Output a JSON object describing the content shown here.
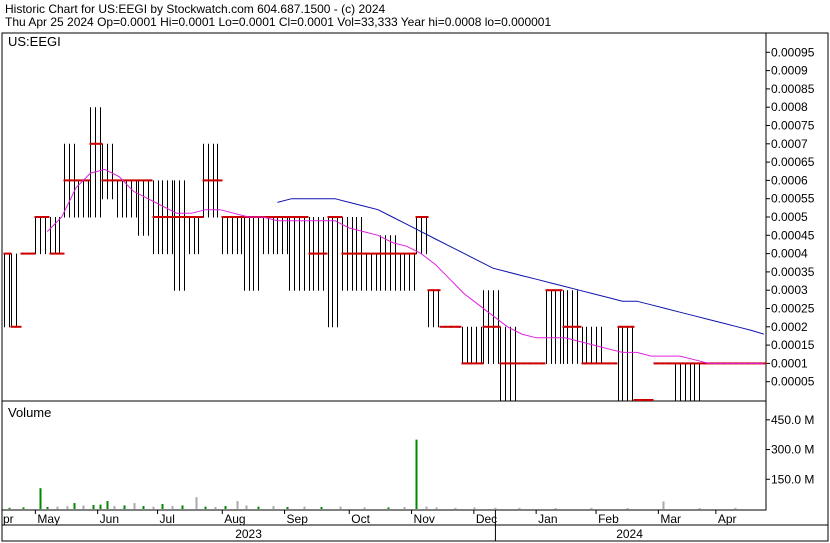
{
  "header": {
    "line1": "Historic Chart for US:EEGI by Stockwatch.com 604.687.1500 - (c) 2024",
    "line2": "Thu Apr 25 2024   Op=0.0001   Hi=0.0001   Lo=0.0001   Cl=0.0001   Vol=33,333   Year hi=0.0008   lo=0.000001"
  },
  "price_panel": {
    "symbol_label": "US:EEGI"
  },
  "volume_panel": {
    "label": "Volume"
  },
  "colors": {
    "price_bar": "#000000",
    "close_tick": "#cc0000",
    "ma_short": "#e020e0",
    "ma_long": "#1010b0",
    "volume_up": "#008800",
    "volume_flat": "#aaaaaa",
    "volume_down": "#cc0000",
    "axis": "#000000"
  },
  "chart_data": [
    {
      "type": "ohlc",
      "title": "Historic Chart for US:EEGI",
      "ylim": [
        0,
        0.0001
      ],
      "y_ticks": [
        "0.00005",
        "0.0001",
        "0.00015",
        "0.0002",
        "0.00025",
        "0.0003",
        "0.00035",
        "0.0004",
        "0.00045",
        "0.0005",
        "0.00055",
        "0.0006",
        "0.00065",
        "0.0007",
        "0.00075",
        "0.0008",
        "0.00085",
        "0.0009",
        "0.00095"
      ],
      "y_tick_values": [
        5e-05,
        0.0001,
        0.00015,
        0.0002,
        0.00025,
        0.0003,
        0.00035,
        0.0004,
        0.00045,
        0.0005,
        0.00055,
        0.0006,
        0.00065,
        0.0007,
        0.00075,
        0.0008,
        0.00085,
        0.0009,
        0.00095
      ],
      "y_range": [
        0,
        0.001
      ],
      "x_months": [
        "pr",
        "May",
        "Jun",
        "Jul",
        "Aug",
        "Sep",
        "Oct",
        "Nov",
        "Dec",
        "Jan",
        "Feb",
        "Mar",
        "Apr"
      ],
      "x_years": [
        "2023",
        "2024"
      ],
      "segments": [
        {
          "from": 0,
          "to": 2,
          "close": 0.0004,
          "high": 0.0004,
          "low": 0.0002
        },
        {
          "from": 3,
          "to": 6,
          "close": 0.0002,
          "high": 0.0004,
          "low": 0.0002
        },
        {
          "from": 7,
          "to": 12,
          "close": 0.0004,
          "high": 0.0004,
          "low": 0.0004
        },
        {
          "from": 13,
          "to": 18,
          "close": 0.0005,
          "high": 0.0005,
          "low": 0.0004
        },
        {
          "from": 19,
          "to": 24,
          "close": 0.0004,
          "high": 0.0005,
          "low": 0.0004
        },
        {
          "from": 25,
          "to": 30,
          "close": 0.0006,
          "high": 0.0007,
          "low": 0.0005
        },
        {
          "from": 31,
          "to": 35,
          "close": 0.0006,
          "high": 0.0006,
          "low": 0.0005
        },
        {
          "from": 36,
          "to": 40,
          "close": 0.0007,
          "high": 0.0008,
          "low": 0.0005
        },
        {
          "from": 41,
          "to": 46,
          "close": 0.0006,
          "high": 0.0007,
          "low": 0.00055
        },
        {
          "from": 47,
          "to": 55,
          "close": 0.0006,
          "high": 0.0006,
          "low": 0.0005
        },
        {
          "from": 56,
          "to": 61,
          "close": 0.0006,
          "high": 0.0006,
          "low": 0.00045
        },
        {
          "from": 62,
          "to": 70,
          "close": 0.0005,
          "high": 0.0006,
          "low": 0.0004
        },
        {
          "from": 71,
          "to": 76,
          "close": 0.0005,
          "high": 0.0006,
          "low": 0.0003
        },
        {
          "from": 77,
          "to": 82,
          "close": 0.0005,
          "high": 0.0005,
          "low": 0.0004
        },
        {
          "from": 83,
          "to": 90,
          "close": 0.0006,
          "high": 0.0007,
          "low": 0.0005
        },
        {
          "from": 91,
          "to": 99,
          "close": 0.0005,
          "high": 0.0005,
          "low": 0.0004
        },
        {
          "from": 100,
          "to": 107,
          "close": 0.0005,
          "high": 0.0005,
          "low": 0.0003
        },
        {
          "from": 108,
          "to": 118,
          "close": 0.0005,
          "high": 0.0005,
          "low": 0.0004
        },
        {
          "from": 119,
          "to": 126,
          "close": 0.0005,
          "high": 0.0005,
          "low": 0.0003
        },
        {
          "from": 127,
          "to": 134,
          "close": 0.0004,
          "high": 0.0005,
          "low": 0.0003
        },
        {
          "from": 135,
          "to": 140,
          "close": 0.0005,
          "high": 0.0005,
          "low": 0.0002
        },
        {
          "from": 141,
          "to": 150,
          "close": 0.0004,
          "high": 0.0005,
          "low": 0.0003
        },
        {
          "from": 151,
          "to": 156,
          "close": 0.0004,
          "high": 0.0004,
          "low": 0.0003
        },
        {
          "from": 157,
          "to": 164,
          "close": 0.0004,
          "high": 0.00045,
          "low": 0.0003
        },
        {
          "from": 165,
          "to": 171,
          "close": 0.0004,
          "high": 0.0004,
          "low": 0.0003
        },
        {
          "from": 172,
          "to": 176,
          "close": 0.0005,
          "high": 0.0005,
          "low": 0.0004
        },
        {
          "from": 177,
          "to": 181,
          "close": 0.0003,
          "high": 0.0003,
          "low": 0.0002
        },
        {
          "from": 182,
          "to": 190,
          "close": 0.0002,
          "high": 0.0002,
          "low": 0.0002
        },
        {
          "from": 191,
          "to": 199,
          "close": 0.0001,
          "high": 0.0002,
          "low": 0.0001
        },
        {
          "from": 200,
          "to": 206,
          "close": 0.0002,
          "high": 0.0003,
          "low": 0.0001
        },
        {
          "from": 207,
          "to": 213,
          "close": 0.0001,
          "high": 0.0002,
          "low": 0.0
        },
        {
          "from": 214,
          "to": 225,
          "close": 0.0001,
          "high": 0.0001,
          "low": 0.0001
        },
        {
          "from": 226,
          "to": 232,
          "close": 0.0003,
          "high": 0.0003,
          "low": 0.0001
        },
        {
          "from": 233,
          "to": 240,
          "close": 0.0002,
          "high": 0.0003,
          "low": 0.0001
        },
        {
          "from": 241,
          "to": 250,
          "close": 0.0001,
          "high": 0.0002,
          "low": 0.0001
        },
        {
          "from": 251,
          "to": 255,
          "close": 0.0001,
          "high": 0.0001,
          "low": 0.0001
        },
        {
          "from": 256,
          "to": 262,
          "close": 0.0002,
          "high": 0.0002,
          "low": 0.0
        },
        {
          "from": 263,
          "to": 270,
          "close": 0.0,
          "high": 0.0,
          "low": 0.0
        },
        {
          "from": 271,
          "to": 279,
          "close": 0.0001,
          "high": 0.0001,
          "low": 0.0001
        },
        {
          "from": 280,
          "to": 290,
          "close": 0.0001,
          "high": 0.0001,
          "low": 0.0
        },
        {
          "from": 291,
          "to": 317,
          "close": 0.0001,
          "high": 0.0001,
          "low": 0.0001
        }
      ],
      "ma_short": [
        [
          18,
          0.00046
        ],
        [
          24,
          0.0005
        ],
        [
          30,
          0.00058
        ],
        [
          36,
          0.00062
        ],
        [
          42,
          0.00063
        ],
        [
          48,
          0.00061
        ],
        [
          54,
          0.00057
        ],
        [
          60,
          0.00055
        ],
        [
          66,
          0.00053
        ],
        [
          72,
          0.00051
        ],
        [
          78,
          0.00051
        ],
        [
          84,
          0.00052
        ],
        [
          90,
          0.00052
        ],
        [
          96,
          0.00051
        ],
        [
          102,
          0.0005
        ],
        [
          108,
          0.0005
        ],
        [
          114,
          0.00049
        ],
        [
          120,
          0.00049
        ],
        [
          126,
          0.00049
        ],
        [
          132,
          0.00049
        ],
        [
          138,
          0.00049
        ],
        [
          144,
          0.00047
        ],
        [
          150,
          0.00046
        ],
        [
          156,
          0.00045
        ],
        [
          162,
          0.00043
        ],
        [
          168,
          0.00042
        ],
        [
          174,
          0.0004
        ],
        [
          180,
          0.00037
        ],
        [
          186,
          0.00033
        ],
        [
          192,
          0.00029
        ],
        [
          198,
          0.00026
        ],
        [
          204,
          0.00023
        ],
        [
          210,
          0.0002
        ],
        [
          216,
          0.00018
        ],
        [
          222,
          0.00017
        ],
        [
          228,
          0.00017
        ],
        [
          234,
          0.00017
        ],
        [
          240,
          0.00016
        ],
        [
          246,
          0.00015
        ],
        [
          252,
          0.00014
        ],
        [
          258,
          0.00013
        ],
        [
          264,
          0.00013
        ],
        [
          270,
          0.00012
        ],
        [
          276,
          0.00012
        ],
        [
          282,
          0.00012
        ],
        [
          288,
          0.00011
        ],
        [
          294,
          0.0001
        ],
        [
          300,
          0.0001
        ],
        [
          306,
          0.0001
        ],
        [
          317,
          0.0001
        ]
      ],
      "ma_long": [
        [
          114,
          0.00054
        ],
        [
          120,
          0.00055
        ],
        [
          126,
          0.00055
        ],
        [
          132,
          0.00055
        ],
        [
          138,
          0.00055
        ],
        [
          144,
          0.00054
        ],
        [
          150,
          0.00053
        ],
        [
          156,
          0.00052
        ],
        [
          162,
          0.0005
        ],
        [
          168,
          0.00048
        ],
        [
          174,
          0.00046
        ],
        [
          180,
          0.00044
        ],
        [
          186,
          0.00042
        ],
        [
          192,
          0.0004
        ],
        [
          198,
          0.00038
        ],
        [
          204,
          0.00036
        ],
        [
          210,
          0.00035
        ],
        [
          216,
          0.00034
        ],
        [
          222,
          0.00033
        ],
        [
          228,
          0.00032
        ],
        [
          234,
          0.00031
        ],
        [
          240,
          0.0003
        ],
        [
          246,
          0.00029
        ],
        [
          252,
          0.00028
        ],
        [
          258,
          0.00027
        ],
        [
          264,
          0.00027
        ],
        [
          270,
          0.00026
        ],
        [
          276,
          0.00025
        ],
        [
          282,
          0.00024
        ],
        [
          288,
          0.00023
        ],
        [
          294,
          0.00022
        ],
        [
          300,
          0.00021
        ],
        [
          306,
          0.0002
        ],
        [
          312,
          0.00019
        ],
        [
          317,
          0.00018
        ]
      ]
    },
    {
      "type": "bar",
      "title": "Volume",
      "y_ticks": [
        "150.0 M",
        "300.0 M",
        "450.0 M"
      ],
      "y_tick_values": [
        150,
        300,
        450
      ],
      "y_range": [
        0,
        540
      ],
      "ylabel": "",
      "bars": [
        {
          "i": 2,
          "v": 6,
          "c": "up"
        },
        {
          "i": 8,
          "v": 8,
          "c": "up"
        },
        {
          "i": 15,
          "v": 105,
          "c": "up"
        },
        {
          "i": 18,
          "v": 10,
          "c": "up"
        },
        {
          "i": 22,
          "v": 12,
          "c": "flat"
        },
        {
          "i": 26,
          "v": 14,
          "c": "flat"
        },
        {
          "i": 29,
          "v": 30,
          "c": "up"
        },
        {
          "i": 33,
          "v": 18,
          "c": "flat"
        },
        {
          "i": 37,
          "v": 20,
          "c": "up"
        },
        {
          "i": 40,
          "v": 22,
          "c": "up"
        },
        {
          "i": 43,
          "v": 40,
          "c": "up"
        },
        {
          "i": 46,
          "v": 15,
          "c": "flat"
        },
        {
          "i": 50,
          "v": 18,
          "c": "up"
        },
        {
          "i": 54,
          "v": 30,
          "c": "flat"
        },
        {
          "i": 58,
          "v": 15,
          "c": "up"
        },
        {
          "i": 62,
          "v": 12,
          "c": "flat"
        },
        {
          "i": 66,
          "v": 25,
          "c": "up"
        },
        {
          "i": 70,
          "v": 15,
          "c": "flat"
        },
        {
          "i": 74,
          "v": 18,
          "c": "up"
        },
        {
          "i": 80,
          "v": 60,
          "c": "flat"
        },
        {
          "i": 84,
          "v": 12,
          "c": "up"
        },
        {
          "i": 88,
          "v": 10,
          "c": "flat"
        },
        {
          "i": 92,
          "v": 15,
          "c": "up"
        },
        {
          "i": 97,
          "v": 40,
          "c": "flat"
        },
        {
          "i": 101,
          "v": 18,
          "c": "flat"
        },
        {
          "i": 106,
          "v": 12,
          "c": "up"
        },
        {
          "i": 112,
          "v": 15,
          "c": "flat"
        },
        {
          "i": 118,
          "v": 10,
          "c": "up"
        },
        {
          "i": 125,
          "v": 12,
          "c": "flat"
        },
        {
          "i": 132,
          "v": 10,
          "c": "up"
        },
        {
          "i": 140,
          "v": 12,
          "c": "flat"
        },
        {
          "i": 150,
          "v": 8,
          "c": "flat"
        },
        {
          "i": 160,
          "v": 8,
          "c": "up"
        },
        {
          "i": 167,
          "v": 10,
          "c": "flat"
        },
        {
          "i": 172,
          "v": 350,
          "c": "up"
        },
        {
          "i": 176,
          "v": 12,
          "c": "flat"
        },
        {
          "i": 180,
          "v": 8,
          "c": "flat"
        },
        {
          "i": 188,
          "v": 6,
          "c": "flat"
        },
        {
          "i": 196,
          "v": 8,
          "c": "flat"
        },
        {
          "i": 205,
          "v": 6,
          "c": "flat"
        },
        {
          "i": 215,
          "v": 6,
          "c": "flat"
        },
        {
          "i": 230,
          "v": 5,
          "c": "flat"
        },
        {
          "i": 245,
          "v": 6,
          "c": "flat"
        },
        {
          "i": 260,
          "v": 5,
          "c": "flat"
        },
        {
          "i": 275,
          "v": 38,
          "c": "flat"
        },
        {
          "i": 290,
          "v": 5,
          "c": "flat"
        },
        {
          "i": 305,
          "v": 6,
          "c": "flat"
        }
      ]
    }
  ]
}
